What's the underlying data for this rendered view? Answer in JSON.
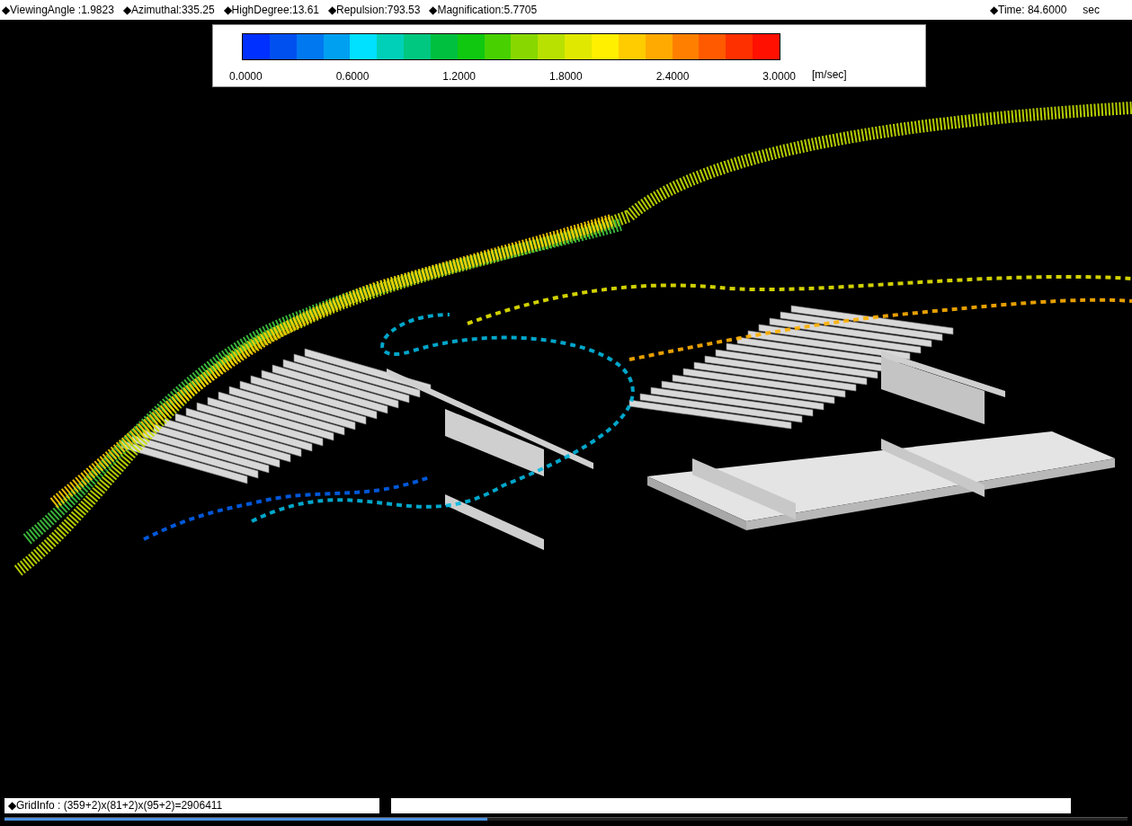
{
  "header": {
    "parameters": [
      "◆ViewingAngle :1.9823",
      "◆Azimuthal:335.25",
      "◆HighDegree:13.61",
      "◆Repulsion:793.53",
      "◆Magnification:5.7705"
    ],
    "time": "◆Time: 84.6000",
    "time_unit": "sec"
  },
  "legend": {
    "swatches": [
      {
        "color": "#0030ff"
      },
      {
        "color": "#0050f0"
      },
      {
        "color": "#0078f0"
      },
      {
        "color": "#00a0f0"
      },
      {
        "color": "#00e0ff"
      },
      {
        "color": "#00d0b8"
      },
      {
        "color": "#00c880"
      },
      {
        "color": "#00c040"
      },
      {
        "color": "#10c810"
      },
      {
        "color": "#48d000"
      },
      {
        "color": "#88d800"
      },
      {
        "color": "#b8e000"
      },
      {
        "color": "#e0e800"
      },
      {
        "color": "#fff000"
      },
      {
        "color": "#ffcc00"
      },
      {
        "color": "#ffaa00"
      },
      {
        "color": "#ff8000"
      },
      {
        "color": "#ff5a00"
      },
      {
        "color": "#ff3000"
      },
      {
        "color": "#ff1000"
      }
    ],
    "labels": [
      "0.0000",
      "0.6000",
      "1.2000",
      "1.8000",
      "2.4000",
      "3.0000"
    ],
    "unit": "[m/sec]"
  },
  "status_bar": {
    "grid_info": "◆GridInfo : (359+2)x(81+2)x(95+2)=2906411",
    "progress": {
      "level": 0.43
    }
  }
}
